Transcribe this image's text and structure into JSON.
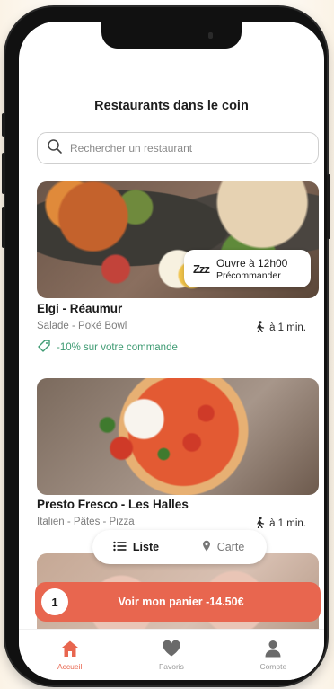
{
  "header": {
    "title": "Restaurants dans le coin"
  },
  "search": {
    "placeholder": "Rechercher un restaurant"
  },
  "restaurants": [
    {
      "name": "Elgi - Réaumur",
      "tags": "Salade - Poké Bowl",
      "distance": "à 1 min.",
      "promo": "-10% sur votre commande",
      "status_title": "Ouvre à 12h00",
      "status_sub": "Précommander",
      "status_icon": "Zzz"
    },
    {
      "name": "Presto Fresco - Les Halles",
      "tags": "Italien - Pâtes - Pizza",
      "distance": "à 1 min."
    }
  ],
  "view_toggle": {
    "list_label": "Liste",
    "map_label": "Carte",
    "selected": "Liste"
  },
  "cart": {
    "count": "1",
    "label": "Voir mon panier -14.50€"
  },
  "tabbar": {
    "items": [
      {
        "label": "Accueil",
        "icon": "home-icon",
        "active": true
      },
      {
        "label": "Favoris",
        "icon": "heart-icon",
        "active": false
      },
      {
        "label": "Compte",
        "icon": "user-icon",
        "active": false
      }
    ]
  },
  "colors": {
    "accent": "#e8664f",
    "promo": "#3f9b73",
    "text": "#1a1a1a",
    "muted": "#7e7e7e"
  }
}
